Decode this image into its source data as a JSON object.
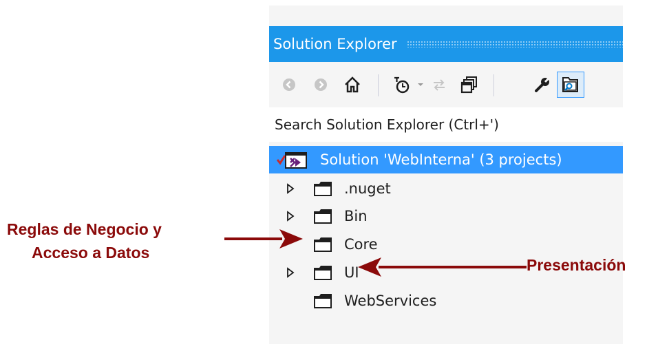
{
  "solution_explorer": {
    "title": "Solution Explorer",
    "toolbar": {
      "icons": [
        "back-icon",
        "forward-icon",
        "home-icon",
        "history-icon",
        "dropdown-icon",
        "sync-icon",
        "collapse-all-icon",
        "properties-icon",
        "preview-icon"
      ]
    },
    "search": {
      "placeholder": "Search Solution Explorer (Ctrl+')"
    },
    "tree": {
      "solution": {
        "label": "Solution 'WebInterna' (3 projects)"
      },
      "items": [
        {
          "label": ".nuget",
          "expandable": true
        },
        {
          "label": "Bin",
          "expandable": true
        },
        {
          "label": "Core",
          "expandable": false
        },
        {
          "label": "UI",
          "expandable": true
        },
        {
          "label": "WebServices",
          "expandable": false
        }
      ]
    }
  },
  "annotations": {
    "left_line1": "Reglas de Negocio y",
    "left_line2": "Acceso a Datos",
    "right": "Presentación",
    "color": "#8b0a0a"
  },
  "colors": {
    "title_bar": "#1c97ea",
    "selection": "#3399ff",
    "panel_bg": "#f5f5f5"
  }
}
